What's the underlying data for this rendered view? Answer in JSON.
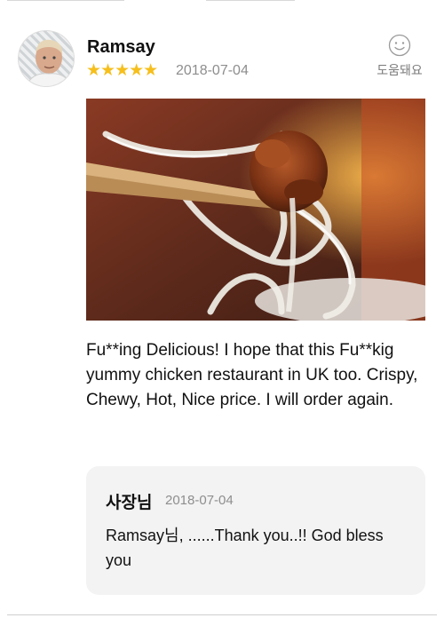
{
  "review": {
    "username": "Ramsay",
    "rating_stars": "★★★★★",
    "rating_value": 5,
    "date": "2018-07-04",
    "helpful_icon": "smile-icon",
    "helpful_label": "도움돼요",
    "photo_description": "",
    "text": "Fu**ing Delicious! I hope that this Fu**kig yummy chicken restaurant in UK too. Crispy, Chewy, Hot, Nice price. I will order again."
  },
  "reply": {
    "author": "사장님",
    "date": "2018-07-04",
    "text": "Ramsay님, ......Thank you..!! God bless you"
  },
  "colors": {
    "star": "#f6bf1c",
    "meta_text": "#8e8e8e",
    "reply_background": "#f3f3f3"
  }
}
